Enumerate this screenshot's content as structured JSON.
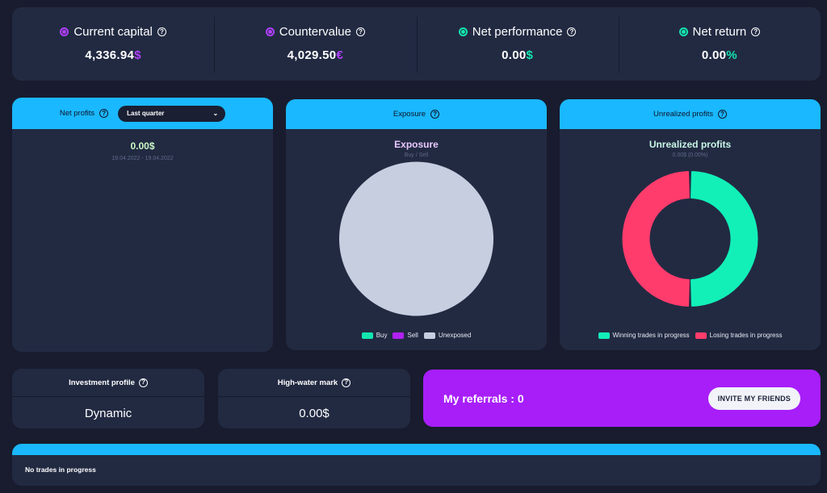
{
  "stats": [
    {
      "label": "Current capital",
      "value": "4,336.94",
      "unit": "$",
      "dot": "purple"
    },
    {
      "label": "Countervalue",
      "value": "4,029.50",
      "unit": "€",
      "dot": "purple"
    },
    {
      "label": "Net performance",
      "value": "0.00",
      "unit": "$",
      "dot": "green"
    },
    {
      "label": "Net return",
      "value": "0.00",
      "unit": "%",
      "dot": "green"
    }
  ],
  "net_profits": {
    "title": "Net profits",
    "period_selected": "Last quarter",
    "value": "0.00$",
    "date_range": "19.04.2022 - 19.04.2022"
  },
  "exposure": {
    "header": "Exposure",
    "chart_title": "Exposure",
    "chart_subtitle": "Buy / Sell",
    "legend": [
      {
        "label": "Buy",
        "color": "#12e6b0"
      },
      {
        "label": "Sell",
        "color": "#b020f2"
      },
      {
        "label": "Unexposed",
        "color": "#c6cee0"
      }
    ]
  },
  "unrealized": {
    "header": "Unrealized profits",
    "chart_title": "Unrealized profits",
    "chart_subtitle": "0.00$ (0.00%)",
    "legend": [
      {
        "label": "Winning trades in progress",
        "color": "#12f0b8"
      },
      {
        "label": "Losing trades in progress",
        "color": "#ff3c6c"
      }
    ]
  },
  "chart_data": [
    {
      "type": "pie",
      "title": "Exposure",
      "subtitle": "Buy / Sell",
      "categories": [
        "Buy",
        "Sell",
        "Unexposed"
      ],
      "values": [
        0,
        0,
        100
      ],
      "colors": [
        "#12e6b0",
        "#b020f2",
        "#c6cee0"
      ],
      "legend": "bottom"
    },
    {
      "type": "pie",
      "title": "Unrealized profits",
      "subtitle": "0.00$ (0.00%)",
      "categories": [
        "Winning trades in progress",
        "Losing trades in progress"
      ],
      "values": [
        50,
        50
      ],
      "colors": [
        "#12f0b8",
        "#ff3c6c"
      ],
      "legend": "bottom",
      "donut": true
    }
  ],
  "investment_profile": {
    "label": "Investment profile",
    "value": "Dynamic"
  },
  "high_water_mark": {
    "label": "High-water mark",
    "value": "0.00$"
  },
  "referrals": {
    "label": "My referrals : 0",
    "button": "INVITE MY FRIENDS"
  },
  "trades": {
    "empty_text": "No trades in progress"
  },
  "colors": {
    "background": "#181c2e",
    "card": "#222a42",
    "accent_blue": "#1ab8ff",
    "accent_purple": "#a71ef9",
    "accent_green": "#12e6b0"
  }
}
